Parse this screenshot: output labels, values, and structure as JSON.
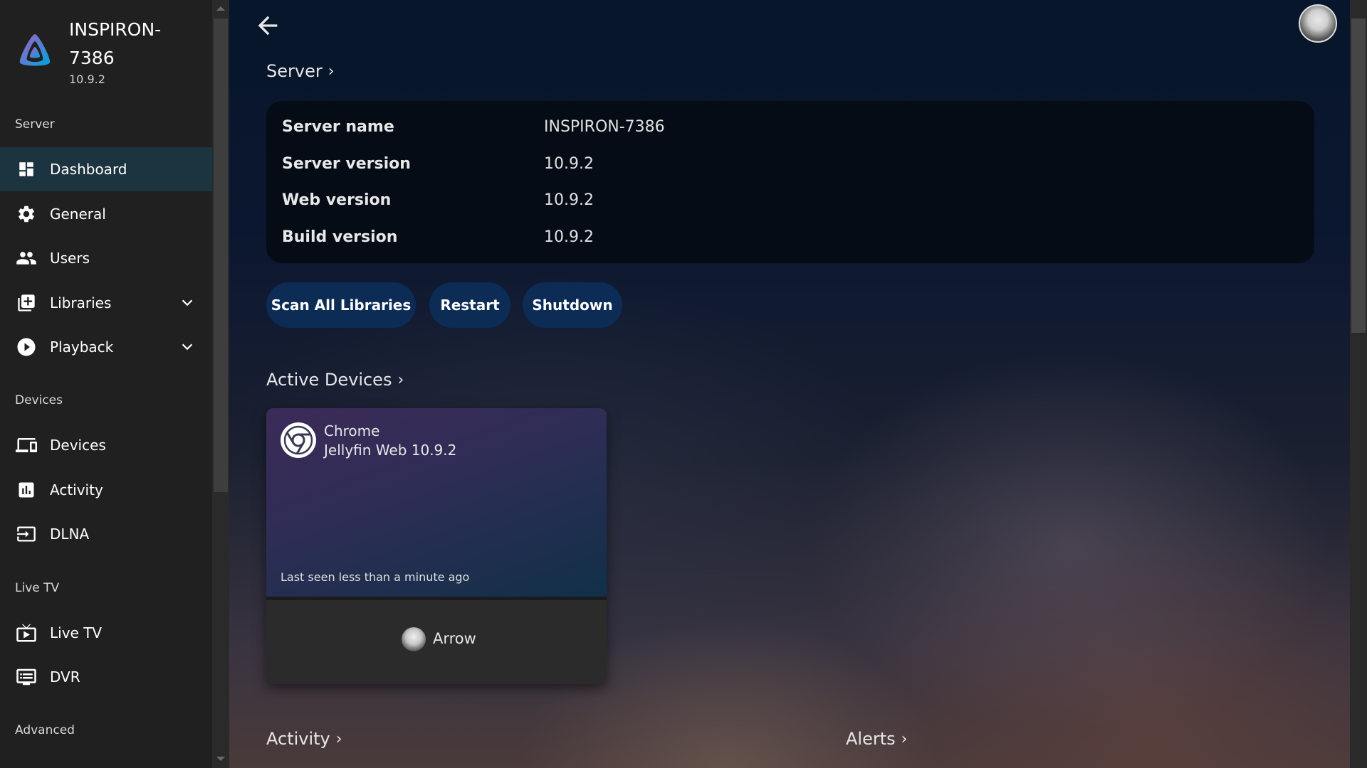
{
  "app": {
    "server_name_line1": "INSPIRON-",
    "server_name_line2": "7386",
    "version": "10.9.2",
    "accent": "#00a4dc"
  },
  "sidebar": {
    "sections": {
      "server": "Server",
      "devices": "Devices",
      "livetv": "Live TV",
      "advanced": "Advanced"
    },
    "items": [
      {
        "label": "Dashboard",
        "icon": "dashboard-icon",
        "active": true
      },
      {
        "label": "General",
        "icon": "gear-icon"
      },
      {
        "label": "Users",
        "icon": "users-icon"
      },
      {
        "label": "Libraries",
        "icon": "library-add-icon",
        "expandable": true
      },
      {
        "label": "Playback",
        "icon": "play-circle-icon",
        "expandable": true
      },
      {
        "label": "Devices",
        "icon": "devices-icon"
      },
      {
        "label": "Activity",
        "icon": "activity-icon"
      },
      {
        "label": "DLNA",
        "icon": "input-icon"
      },
      {
        "label": "Live TV",
        "icon": "live-tv-icon"
      },
      {
        "label": "DVR",
        "icon": "dvr-icon"
      }
    ]
  },
  "main": {
    "server_section": "Server",
    "server_info": [
      {
        "key": "Server name",
        "value": "INSPIRON-7386"
      },
      {
        "key": "Server version",
        "value": "10.9.2"
      },
      {
        "key": "Web version",
        "value": "10.9.2"
      },
      {
        "key": "Build version",
        "value": "10.9.2"
      }
    ],
    "buttons": {
      "scan": "Scan All Libraries",
      "restart": "Restart",
      "shutdown": "Shutdown"
    },
    "active_devices_section": "Active Devices",
    "device": {
      "client": "Chrome",
      "app": "Jellyfin Web 10.9.2",
      "last_seen": "Last seen less than a minute ago",
      "user": "Arrow"
    },
    "activity_section": "Activity",
    "alerts_section": "Alerts"
  }
}
